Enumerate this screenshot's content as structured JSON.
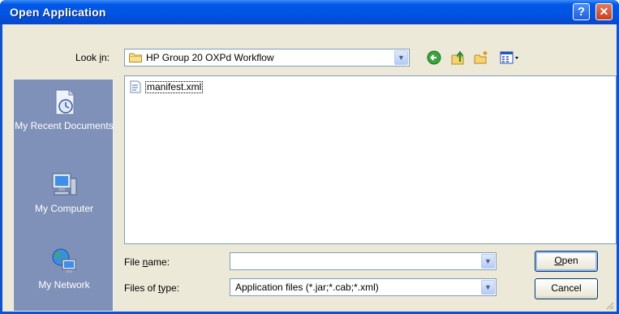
{
  "window": {
    "title": "Open Application",
    "help_button": "?",
    "close_button": "✕"
  },
  "lookin": {
    "label_pre": "Look ",
    "label_key": "i",
    "label_post": "n:",
    "value": "HP Group 20 OXPd Workflow"
  },
  "toolbar": {
    "back": "back-icon",
    "up": "up-folder-icon",
    "new_folder": "new-folder-icon",
    "views": "views-menu-icon"
  },
  "places": [
    {
      "label": "My Recent Documents",
      "icon": "recent-documents-icon"
    },
    {
      "label": "My Computer",
      "icon": "my-computer-icon"
    },
    {
      "label": "My Network",
      "icon": "my-network-icon"
    }
  ],
  "files": [
    {
      "name": "manifest.xml",
      "icon": "xml-file-icon"
    }
  ],
  "filename": {
    "label_pre": "File ",
    "label_key": "n",
    "label_post": "ame:",
    "value": ""
  },
  "filetype": {
    "label_pre": "Files of ",
    "label_key": "t",
    "label_post": "ype:",
    "value": "Application files (*.jar;*.cab;*.xml)"
  },
  "buttons": {
    "open_key": "O",
    "open_rest": "pen",
    "cancel": "Cancel"
  }
}
